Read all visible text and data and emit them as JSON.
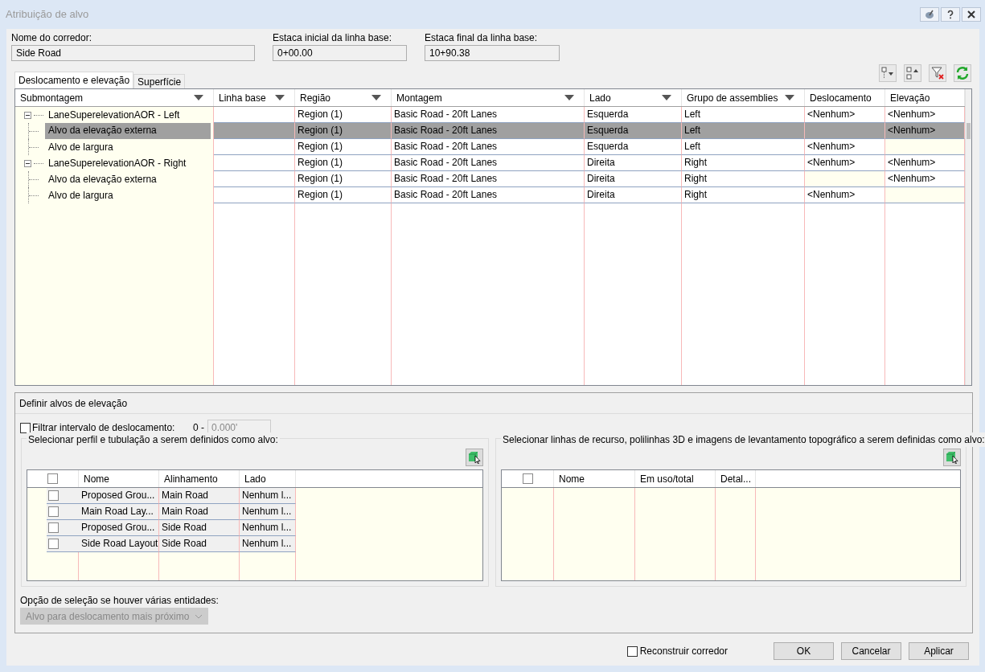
{
  "window": {
    "title": "Atribuição de alvo"
  },
  "fields": [
    {
      "label": "Nome do corredor:",
      "value": "Side Road"
    },
    {
      "label": "Estaca inicial da linha base:",
      "value": "0+00.00"
    },
    {
      "label": "Estaca final da linha base:",
      "value": "10+90.38"
    }
  ],
  "tabs": [
    {
      "label": "Deslocamento e elevação",
      "selected": true
    },
    {
      "label": "Superfície",
      "selected": false
    }
  ],
  "grid": {
    "columns": [
      {
        "label": "Submontagem",
        "filter": true
      },
      {
        "label": "Linha base",
        "filter": true
      },
      {
        "label": "Região",
        "filter": true
      },
      {
        "label": "Montagem",
        "filter": true
      },
      {
        "label": "Lado",
        "filter": true
      },
      {
        "label": "Grupo de assemblies",
        "filter": true
      },
      {
        "label": "Deslocamento",
        "filter": false
      },
      {
        "label": "Elevação",
        "filter": false
      }
    ],
    "rows": [
      {
        "label": "LaneSuperelevationAOR - Left",
        "expanded": true,
        "selected": false,
        "regiao": "Region (1)",
        "montagem": "Basic Road - 20ft Lanes",
        "lado": "Esquerda",
        "grupo": "Left",
        "deslocamento": "<Nenhum>",
        "elevacao": "<Nenhum>",
        "children": [
          {
            "label": "Alvo da elevação externa",
            "selected": true,
            "regiao": "Region (1)",
            "montagem": "Basic Road - 20ft Lanes",
            "lado": "Esquerda",
            "grupo": "Left",
            "elevacao": "<Nenhum>"
          },
          {
            "label": "Alvo de largura",
            "selected": false,
            "regiao": "Region (1)",
            "montagem": "Basic Road - 20ft Lanes",
            "lado": "Esquerda",
            "grupo": "Left",
            "deslocamento": "<Nenhum>"
          }
        ]
      },
      {
        "label": "LaneSuperelevationAOR - Right",
        "expanded": true,
        "selected": false,
        "regiao": "Region (1)",
        "montagem": "Basic Road - 20ft Lanes",
        "lado": "Direita",
        "grupo": "Right",
        "deslocamento": "<Nenhum>",
        "elevacao": "<Nenhum>",
        "children": [
          {
            "label": "Alvo da elevação externa",
            "selected": false,
            "regiao": "Region (1)",
            "montagem": "Basic Road - 20ft Lanes",
            "lado": "Direita",
            "grupo": "Right",
            "elevacao": "<Nenhum>"
          },
          {
            "label": "Alvo de largura",
            "selected": false,
            "regiao": "Region (1)",
            "montagem": "Basic Road - 20ft Lanes",
            "lado": "Direita",
            "grupo": "Right",
            "deslocamento": "<Nenhum>"
          }
        ]
      }
    ]
  },
  "elevation_targets": {
    "title": "Definir alvos de elevação",
    "filter": {
      "label": "Filtrar intervalo de deslocamento:",
      "checked": false,
      "range_start": "0 -",
      "range_end": "0.000'",
      "range_disabled": true
    },
    "profiles": {
      "legend": "Selecionar perfil e tubulação a serem definidos como alvo:",
      "header_checked": false,
      "columns": [
        "Nome",
        "Alinhamento",
        "Lado"
      ],
      "rows": [
        {
          "nome": "Proposed Grou...",
          "alinhamento": "Main Road",
          "lado": "Nenhum l...",
          "checked": false
        },
        {
          "nome": "Main Road Lay...",
          "alinhamento": "Main Road",
          "lado": "Nenhum l...",
          "checked": false
        },
        {
          "nome": "Proposed Grou...",
          "alinhamento": "Side Road",
          "lado": "Nenhum l...",
          "checked": false
        },
        {
          "nome": "Side Road Layout",
          "alinhamento": "Side Road",
          "lado": "Nenhum l...",
          "checked": false
        }
      ]
    },
    "features": {
      "legend": "Selecionar linhas de recurso, polilinhas 3D e imagens de levantamento topográfico a serem definidas como alvo:",
      "header_checked": false,
      "columns": [
        "Nome",
        "Em uso/total",
        "Detal..."
      ]
    },
    "selection_option": {
      "label": "Opção de seleção se houver várias entidades:",
      "value": "Alvo para deslocamento mais próximo",
      "disabled": true
    }
  },
  "rebuild": {
    "label": "Reconstruir corredor",
    "checked": false
  },
  "buttons": [
    "OK",
    "Cancelar",
    "Aplicar"
  ]
}
